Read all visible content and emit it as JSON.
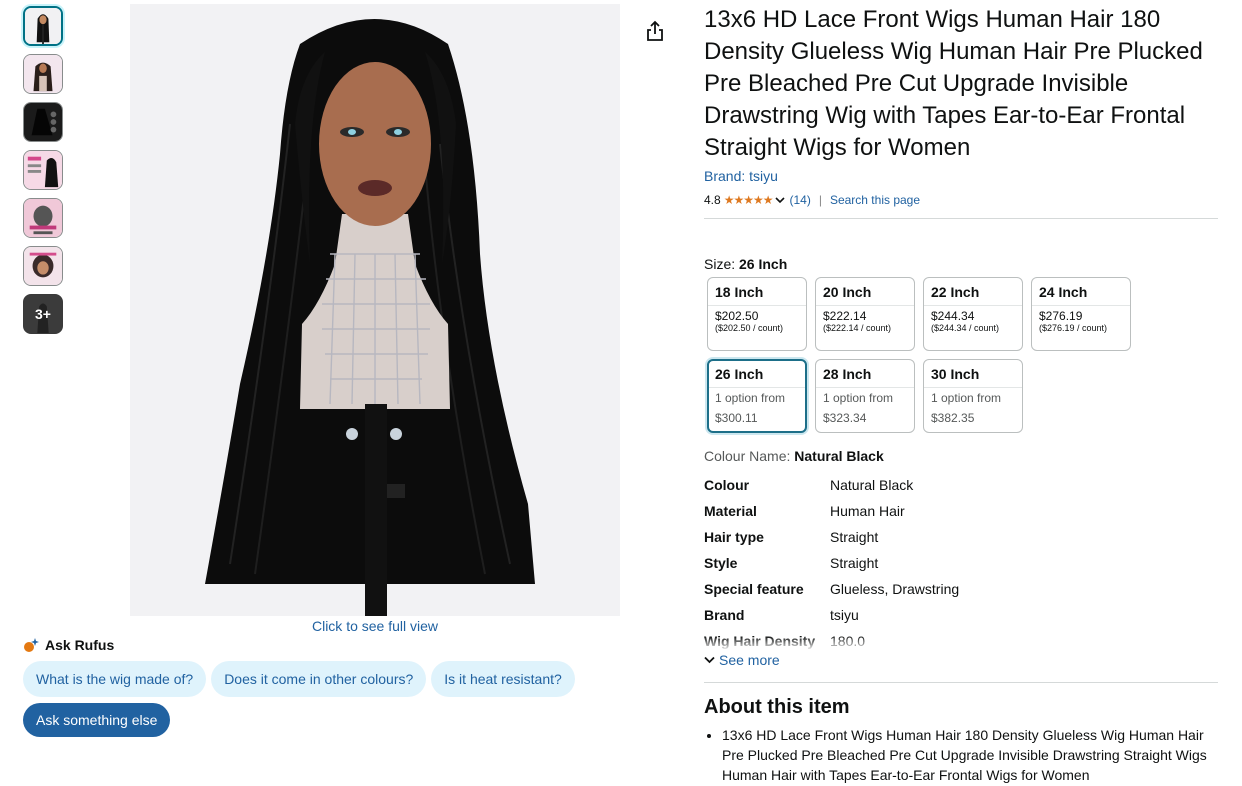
{
  "product": {
    "title": "13x6 HD Lace Front Wigs Human Hair 180 Density Glueless Wig Human Hair Pre Plucked Pre Bleached Pre Cut Upgrade Invisible Drawstring Wig with Tapes Ear-to-Ear Frontal Straight Wigs for Women",
    "brand_link": "Brand: tsiyu",
    "rating": "4.8",
    "stars": "★★★★★",
    "rating_count": "(14)",
    "search_link": "Search this page"
  },
  "gallery": {
    "more_label": "3+",
    "full_view_link": "Click to see full view"
  },
  "rufus": {
    "title": "Ask Rufus",
    "chips": [
      "What is the wig made of?",
      "Does it come in other colours?",
      "Is it heat resistant?"
    ],
    "ask_button": "Ask something else"
  },
  "size": {
    "label": "Size:",
    "selected": "26 Inch",
    "options": [
      {
        "name": "18 Inch",
        "price": "$202.50",
        "unit": "($202.50 / count)"
      },
      {
        "name": "20 Inch",
        "price": "$222.14",
        "unit": "($222.14 / count)"
      },
      {
        "name": "22 Inch",
        "price": "$244.34",
        "unit": "($244.34 / count)"
      },
      {
        "name": "24 Inch",
        "price": "$276.19",
        "unit": "($276.19 / count)"
      },
      {
        "name": "26 Inch",
        "option": "1 option from",
        "from_price": "$300.11"
      },
      {
        "name": "28 Inch",
        "option": "1 option from",
        "from_price": "$323.34"
      },
      {
        "name": "30 Inch",
        "option": "1 option from",
        "from_price": "$382.35"
      }
    ]
  },
  "colour": {
    "label": "Colour Name:",
    "value": "Natural Black"
  },
  "attributes": [
    {
      "key": "Colour",
      "value": "Natural Black"
    },
    {
      "key": "Material",
      "value": "Human Hair"
    },
    {
      "key": "Hair type",
      "value": "Straight"
    },
    {
      "key": "Style",
      "value": "Straight"
    },
    {
      "key": "Special feature",
      "value": "Glueless, Drawstring"
    },
    {
      "key": "Brand",
      "value": "tsiyu"
    },
    {
      "key": "Wig Hair Density",
      "value": "180.0"
    }
  ],
  "see_more": "See more",
  "about": {
    "title": "About this item",
    "bullets": [
      "13x6 HD Lace Front Wigs Human Hair 180 Density Glueless Wig Human Hair Pre Plucked Pre Bleached Pre Cut Upgrade Invisible Drawstring Straight Wigs Human Hair with Tapes Ear-to-Ear Frontal Wigs for Women"
    ]
  },
  "colors": {
    "link": "#2162a1",
    "star": "#de7921",
    "chip_bg": "#dff3fc",
    "selected_border": "#1d6f89"
  }
}
